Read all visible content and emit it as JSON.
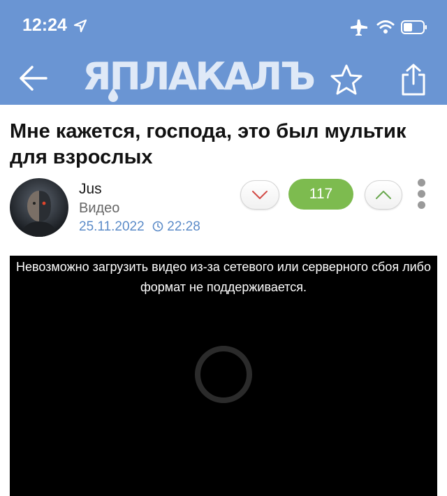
{
  "status_bar": {
    "time": "12:24"
  },
  "nav": {
    "logo_text": "ЯПЛАКАЛЪ"
  },
  "post": {
    "title": "Мне кажется, господа, это был мультик для взрослых",
    "author": "Jus",
    "category": "Видео",
    "date": "25.11.2022",
    "time": "22:28",
    "score": "117"
  },
  "video": {
    "error_message": "Невозможно загрузить видео из-за сетевого или серверного сбоя либо формат не поддерживается."
  },
  "colors": {
    "header_bg": "#6a95d3",
    "score_bg": "#7dbb4f",
    "date_text": "#5b8bc8",
    "video_bg": "#000000"
  },
  "icons": [
    "location-arrow-icon",
    "airplane-icon",
    "wifi-icon",
    "battery-icon",
    "back-arrow-icon",
    "star-icon",
    "share-icon",
    "clock-icon",
    "chevron-down-icon",
    "chevron-up-icon",
    "more-vertical-icon",
    "loading-spinner-icon"
  ]
}
